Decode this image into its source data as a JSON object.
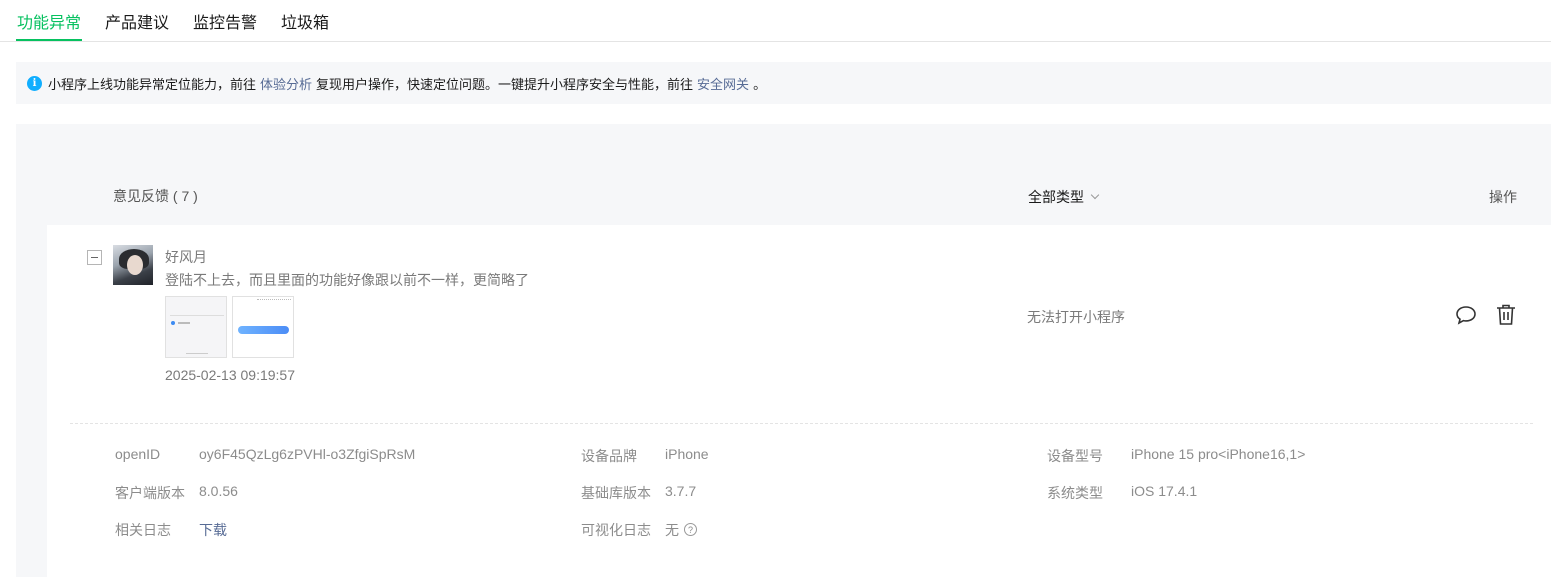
{
  "tabs": [
    {
      "label": "功能异常",
      "active": true
    },
    {
      "label": "产品建议",
      "active": false
    },
    {
      "label": "监控告警",
      "active": false
    },
    {
      "label": "垃圾箱",
      "active": false
    }
  ],
  "notice": {
    "text_before": "小程序上线功能异常定位能力，前往",
    "link1": "体验分析",
    "text_middle": "复现用户操作，快速定位问题。一键提升小程序安全与性能，前往",
    "link2": "安全网关",
    "text_after": "。"
  },
  "table": {
    "feedback_header": "意见反馈 ( 7 )",
    "type_filter": "全部类型",
    "action_header": "操作"
  },
  "feedback": {
    "username": "好风月",
    "content": "登陆不上去，而且里面的功能好像跟以前不一样，更简略了",
    "timestamp": "2025-02-13 09:19:57",
    "type": "无法打开小程序",
    "details": {
      "openid_label": "openID",
      "openid_value": "oy6F45QzLg6zPVHl-o3ZfgiSpRsM",
      "brand_label": "设备品牌",
      "brand_value": "iPhone",
      "model_label": "设备型号",
      "model_value": "iPhone 15 pro<iPhone16,1>",
      "client_label": "客户端版本",
      "client_value": "8.0.56",
      "lib_label": "基础库版本",
      "lib_value": "3.7.7",
      "os_label": "系统类型",
      "os_value": "iOS 17.4.1",
      "log_label": "相关日志",
      "log_link": "下载",
      "visual_log_label": "可视化日志",
      "visual_log_value": "无"
    }
  },
  "colors": {
    "accent": "#07c160",
    "link": "#576b95",
    "info": "#10aeff"
  },
  "icons": [
    "info-icon",
    "chevron-down-icon",
    "collapse-icon",
    "reply-icon",
    "delete-icon",
    "help-icon"
  ]
}
